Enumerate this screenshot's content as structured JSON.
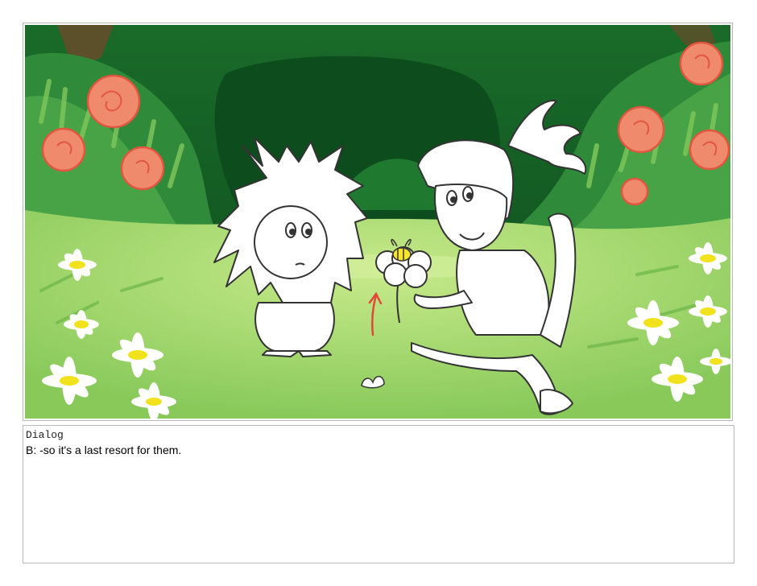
{
  "panel": {
    "colors": {
      "sky_dark": "#0f5a22",
      "bush_mid": "#2f8a3a",
      "bush_light": "#4fae4a",
      "grass": "#8fd15f",
      "grass_light": "#b9e37c",
      "rose": "#f08a6c",
      "rose_outline": "#e0563e",
      "daisy_center": "#f2e21d",
      "character_fill": "#ffffff",
      "outline": "#333333",
      "arrow": "#e2483a",
      "bee_yellow": "#f7e62a"
    }
  },
  "dialog": {
    "heading": "Dialog",
    "line": "B: -so it's a last resort for them."
  }
}
